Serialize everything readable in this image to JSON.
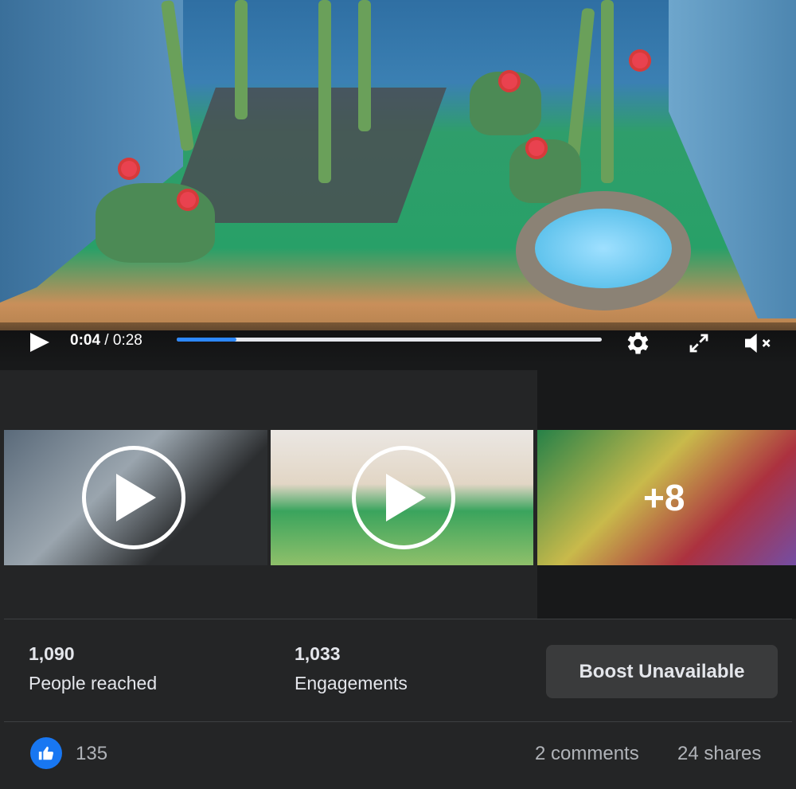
{
  "video": {
    "current_time": "0:04",
    "separator": " / ",
    "duration": "0:28",
    "progress": 0.14
  },
  "icons": {
    "play": "play-icon",
    "settings": "gear-icon",
    "fullscreen": "fullscreen-icon",
    "mute": "muted-speaker-icon",
    "like": "thumbs-up-icon"
  },
  "gallery": {
    "more_count_label": "+8"
  },
  "stats": {
    "reach_value": "1,090",
    "reach_label": "People reached",
    "engagement_value": "1,033",
    "engagement_label": "Engagements",
    "boost_label": "Boost Unavailable"
  },
  "footer": {
    "likes": "135",
    "comments": "2 comments",
    "shares": "24 shares"
  },
  "colors": {
    "accent": "#2d88ff",
    "like_blue": "#1877f2",
    "background": "#242526"
  }
}
